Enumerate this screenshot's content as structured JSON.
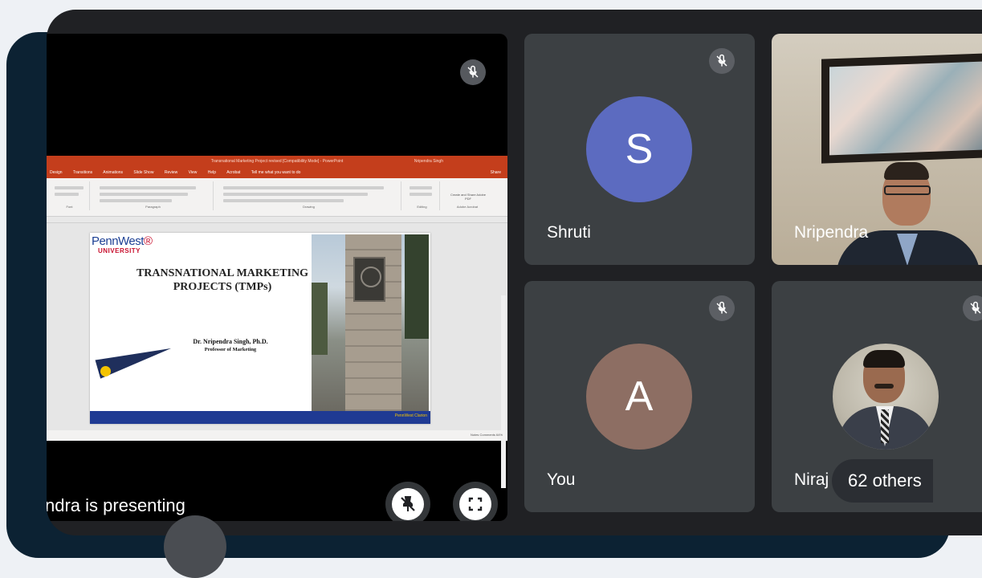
{
  "presentation": {
    "presenter_banner": "ndra is presenting",
    "window_title": "Transnational Marketing Project revised [Compatibility Mode] - PowerPoint",
    "window_user": "Nripendra Singh",
    "menu_items": [
      "Design",
      "Transitions",
      "Animations",
      "Slide Show",
      "Review",
      "View",
      "Help",
      "Acrobat",
      "Tell me what you want to do"
    ],
    "menu_share": "Share",
    "ribbon_groups": [
      "Font",
      "Paragraph",
      "Drawing",
      "Editing",
      "Adobe Acrobat"
    ],
    "ribbon_pdf_label": "Create and Share Adobe PDF",
    "status_text": "Notes   Comments   64%",
    "slide": {
      "logo_main": "PennWest",
      "logo_sub": "UNIVERSITY",
      "title": "TRANSNATIONAL MARKETING PROJECTS (TMPs)",
      "author": "Dr. Nripendra Singh, Ph.D.",
      "author_role": "Professor of Marketing",
      "footer": "PennWest Clarion"
    },
    "unpin_icon": "pin-off-icon",
    "fullscreen_icon": "fullscreen-icon"
  },
  "participants": [
    {
      "name": "Shruti",
      "initial": "S",
      "avatar_color": "#5c6bc0",
      "muted": true
    },
    {
      "name": "Nripendra",
      "video": true,
      "speaking": true
    },
    {
      "name": "You",
      "initial": "A",
      "avatar_color": "#8d6e63",
      "muted": true
    },
    {
      "name": "Niraj",
      "photo": true,
      "muted": true
    }
  ],
  "others_count": "62 others",
  "colors": {
    "meet_bg": "#202124",
    "tile_bg": "#3c4043",
    "ppt_red": "#c43e1c",
    "speaking_teal": "#137a8c",
    "backdrop": "#0c2233"
  }
}
